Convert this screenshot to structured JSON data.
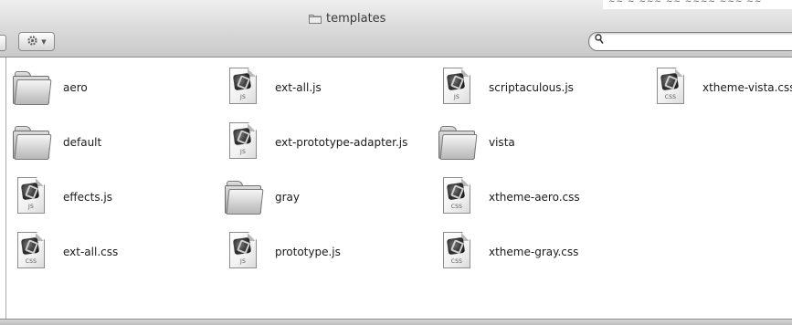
{
  "window": {
    "title": "templates",
    "search": {
      "value": "",
      "placeholder": ""
    }
  },
  "icons": {
    "action": "gear-icon",
    "search": "magnifier-icon",
    "folder": "folder-icon",
    "file": "document-icon"
  },
  "items": [
    {
      "name": "aero",
      "kind": "folder",
      "ext": ""
    },
    {
      "name": "default",
      "kind": "folder",
      "ext": ""
    },
    {
      "name": "effects.js",
      "kind": "file",
      "ext": "JS"
    },
    {
      "name": "ext-all.css",
      "kind": "file",
      "ext": "CSS"
    },
    {
      "name": "ext-all.js",
      "kind": "file",
      "ext": "JS"
    },
    {
      "name": "ext-prototype-adapter.js",
      "kind": "file",
      "ext": "JS"
    },
    {
      "name": "gray",
      "kind": "folder",
      "ext": ""
    },
    {
      "name": "prototype.js",
      "kind": "file",
      "ext": "JS"
    },
    {
      "name": "scriptaculous.js",
      "kind": "file",
      "ext": "JS"
    },
    {
      "name": "vista",
      "kind": "folder",
      "ext": ""
    },
    {
      "name": "xtheme-aero.css",
      "kind": "file",
      "ext": "CSS"
    },
    {
      "name": "xtheme-gray.css",
      "kind": "file",
      "ext": "CSS"
    },
    {
      "name": "xtheme-vista.css",
      "kind": "file",
      "ext": "CSS"
    }
  ]
}
